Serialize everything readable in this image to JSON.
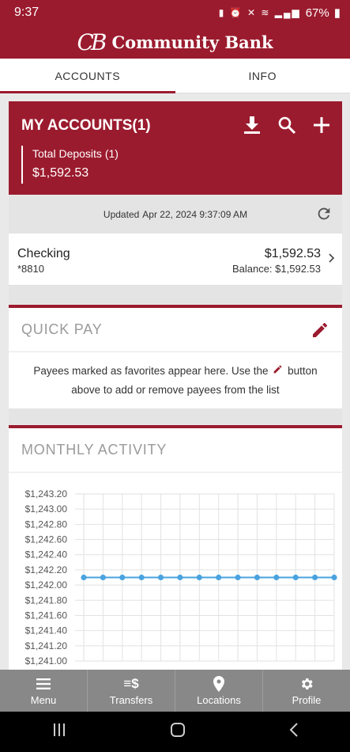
{
  "status": {
    "time": "9:37",
    "battery": "67%"
  },
  "brand": {
    "logo": "CB",
    "name": "Community Bank",
    "color": "#9b1b2e"
  },
  "tabs": [
    {
      "label": "ACCOUNTS",
      "active": true
    },
    {
      "label": "INFO",
      "active": false
    }
  ],
  "accounts": {
    "title": "MY ACCOUNTS(1)",
    "actions": [
      "download-icon",
      "search-icon",
      "plus-icon"
    ],
    "deposits_label": "Total Deposits (1)",
    "deposits_value": "$1,592.53",
    "updated_prefix": "Updated",
    "updated_time": "Apr 22, 2024 9:37:09 AM",
    "list": [
      {
        "name": "Checking",
        "number": "*8810",
        "amount": "$1,592.53",
        "balance": "Balance: $1,592.53"
      }
    ]
  },
  "quick_pay": {
    "title": "QUICK PAY",
    "message_before": "Payees marked as favorites appear here. Use the",
    "message_after": "button above to add or remove payees from the list"
  },
  "monthly_activity": {
    "title": "MONTHLY ACTIVITY"
  },
  "chart_data": {
    "type": "line",
    "title": "",
    "xlabel": "",
    "ylabel": "",
    "ylim": [
      1241.0,
      1243.2
    ],
    "y_ticks": [
      "$1,243.20",
      "$1,243.00",
      "$1,242.80",
      "$1,242.60",
      "$1,242.40",
      "$1,242.20",
      "$1,242.00",
      "$1,241.80",
      "$1,241.60",
      "$1,241.40",
      "$1,241.20",
      "$1,241.00"
    ],
    "series": [
      {
        "values": [
          1242.1,
          1242.1,
          1242.1,
          1242.1,
          1242.1,
          1242.1,
          1242.1,
          1242.1,
          1242.1,
          1242.1,
          1242.1,
          1242.1,
          1242.1,
          1242.1
        ],
        "color": "#4aa3df"
      }
    ],
    "grid": true
  },
  "bottom_nav": [
    {
      "label": "Menu",
      "icon": "menu-icon"
    },
    {
      "label": "Transfers",
      "icon": "transfers-icon"
    },
    {
      "label": "Locations",
      "icon": "location-pin-icon"
    },
    {
      "label": "Profile",
      "icon": "gear-icon"
    }
  ]
}
